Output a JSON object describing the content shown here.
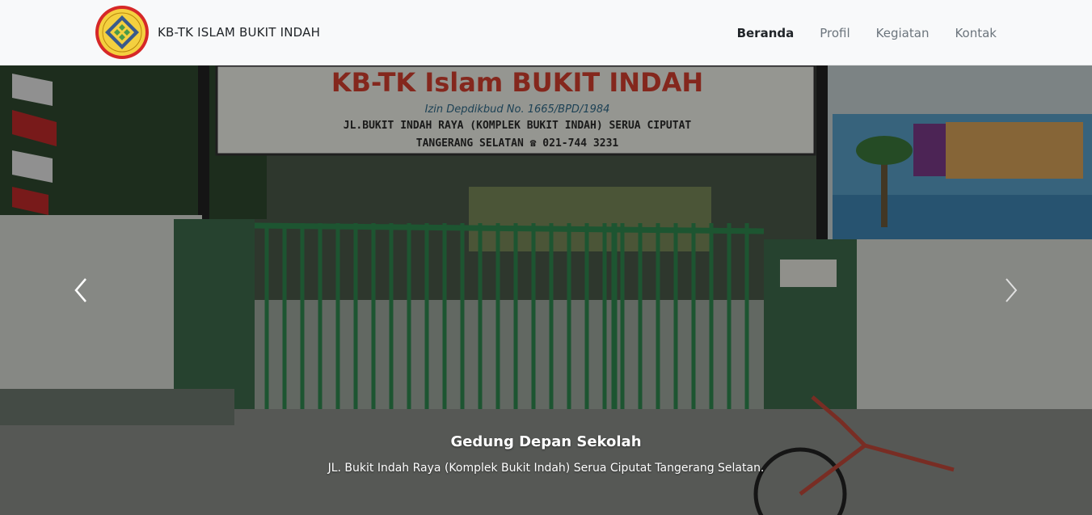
{
  "brand": {
    "name": "KB-TK ISLAM BUKIT INDAH",
    "logo_icon": "school-emblem-icon",
    "logo_colors": {
      "ring": "#d62828",
      "fill": "#f4d03f",
      "diamond": "#3a5a8c"
    }
  },
  "nav": {
    "items": [
      {
        "label": "Beranda",
        "active": true
      },
      {
        "label": "Profil",
        "active": false
      },
      {
        "label": "Kegiatan",
        "active": false
      },
      {
        "label": "Kontak",
        "active": false
      }
    ]
  },
  "carousel": {
    "prev_icon": "chevron-left-icon",
    "next_icon": "chevron-right-icon",
    "slide": {
      "sign_line1": "KB-TK Islam BUKIT INDAH",
      "sign_line2": "Izin Depdikbud No. 1665/BPD/1984",
      "sign_line3": "JL.BUKIT INDAH RAYA (KOMPLEK BUKIT INDAH) SERUA CIPUTAT",
      "sign_line4": "TANGERANG SELATAN  ☎ 021-744 3231",
      "caption_title": "Gedung Depan Sekolah",
      "caption_text": "JL. Bukit Indah Raya (Komplek Bukit Indah) Serua Ciputat Tangerang Selatan."
    }
  },
  "colors": {
    "navbar_bg": "#f8f9fa",
    "nav_active": "#212529",
    "nav_inactive": "#6c757d"
  }
}
